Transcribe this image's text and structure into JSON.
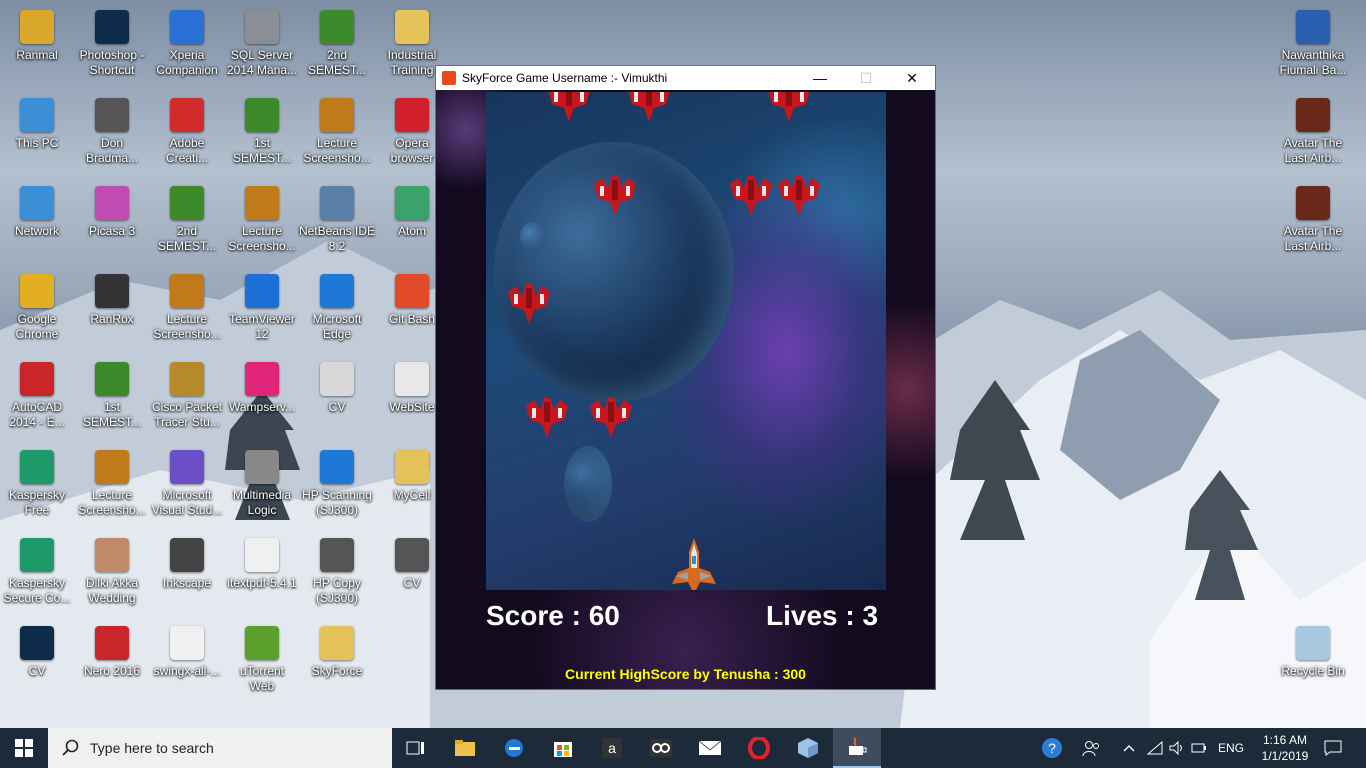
{
  "desktop": {
    "icons": [
      {
        "label": "Ranmal"
      },
      {
        "label": "Photoshop -\nShortcut"
      },
      {
        "label": "Xperia\nCompanion"
      },
      {
        "label": "SQL Server\n2014 Mana..."
      },
      {
        "label": "2nd\nSEMEST..."
      },
      {
        "label": "Industrial\nTraining"
      },
      {
        "label": "This PC"
      },
      {
        "label": "Don\nBradma..."
      },
      {
        "label": "Adobe\nCreati..."
      },
      {
        "label": "1st\nSEMEST..."
      },
      {
        "label": "Lecture\nScreensho..."
      },
      {
        "label": "Opera\nbrowser"
      },
      {
        "label": "Network"
      },
      {
        "label": "Picasa 3"
      },
      {
        "label": "2nd\nSEMEST..."
      },
      {
        "label": "Lecture\nScreensho..."
      },
      {
        "label": "NetBeans IDE\n8.2"
      },
      {
        "label": "Atom"
      },
      {
        "label": "Google\nChrome"
      },
      {
        "label": "RanRox"
      },
      {
        "label": "Lecture\nScreensho..."
      },
      {
        "label": "TeamViewer\n12"
      },
      {
        "label": "Microsoft\nEdge"
      },
      {
        "label": "Git Bash"
      },
      {
        "label": "AutoCAD\n2014 - E..."
      },
      {
        "label": "1st\nSEMEST..."
      },
      {
        "label": "Cisco Packet\nTracer Stu..."
      },
      {
        "label": "Wampserv..."
      },
      {
        "label": "CV"
      },
      {
        "label": "WebSite"
      },
      {
        "label": "Kaspersky\nFree"
      },
      {
        "label": "Lecture\nScreensho..."
      },
      {
        "label": "Microsoft\nVisual Stud..."
      },
      {
        "label": "Multimedia\nLogic"
      },
      {
        "label": "HP Scanning\n(SJ300)"
      },
      {
        "label": "MyCell"
      },
      {
        "label": "Kaspersky\nSecure Co..."
      },
      {
        "label": "Dilki Akka\nWedding"
      },
      {
        "label": "Inkscape"
      },
      {
        "label": "itextpdf-5.4.1"
      },
      {
        "label": "HP Copy\n(SJ300)"
      },
      {
        "label": "CV"
      },
      {
        "label": "CV"
      },
      {
        "label": "Nero 2016"
      },
      {
        "label": "swingx-all-..."
      },
      {
        "label": "uTorrent\nWeb"
      },
      {
        "label": "SkyForce"
      },
      {
        "label": "Nawanthika\nFiumali Ba..."
      },
      {
        "label": "Avatar The\nLast Airb..."
      },
      {
        "label": "Avatar The\nLast Airb..."
      },
      {
        "label": "Recycle Bin"
      }
    ]
  },
  "window": {
    "title": "SkyForce Game  Username  :- Vimukthi",
    "min": "—",
    "max": "☐",
    "close": "✕"
  },
  "game": {
    "score_text": "Score : 60",
    "lives_text": "Lives : 3",
    "highscore_text": "Current HighScore by Tenusha : 300",
    "score": 60,
    "lives": 3,
    "enemy_count": 10
  },
  "taskbar": {
    "search_placeholder": "Type here to search",
    "lang": "ENG",
    "time": "1:16 AM",
    "date": "1/1/2019"
  }
}
